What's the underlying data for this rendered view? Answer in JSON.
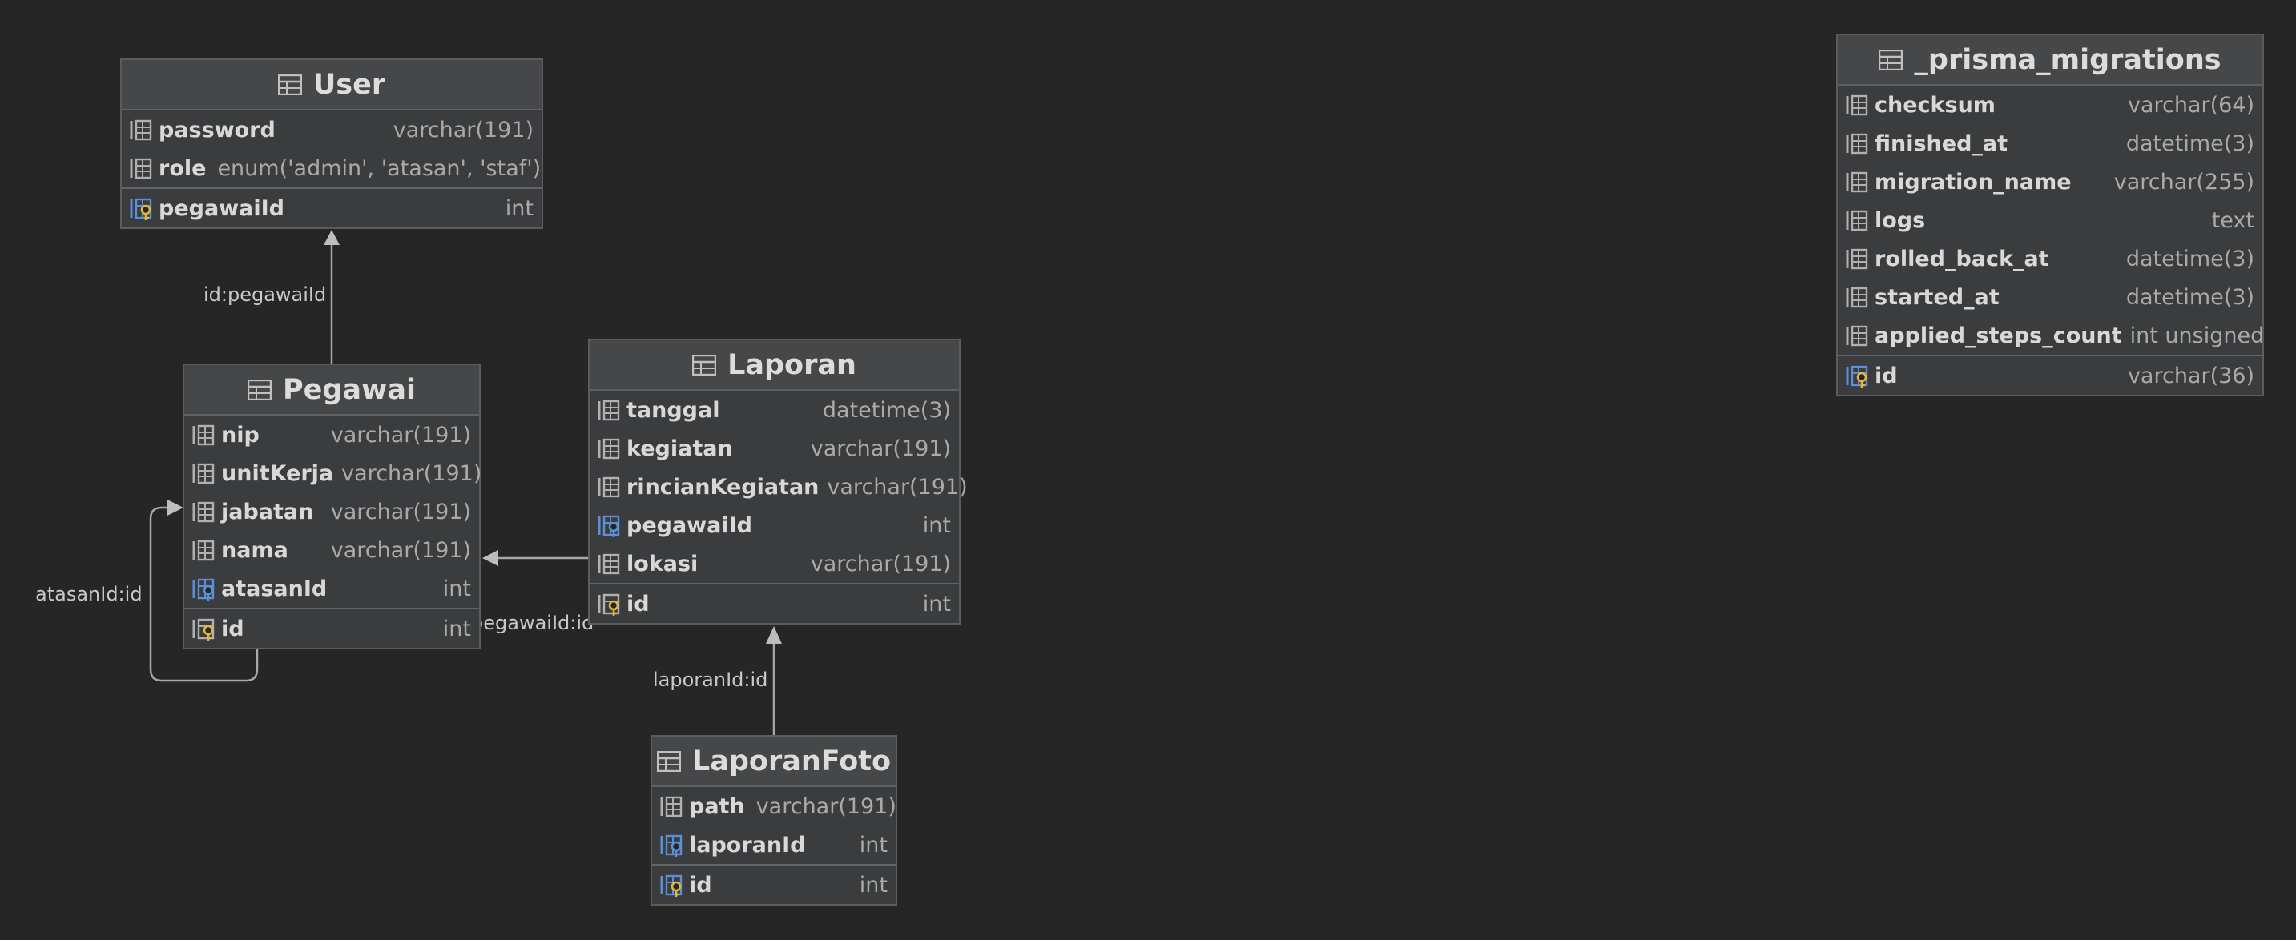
{
  "tables": {
    "user": {
      "title": "User",
      "columns": [
        {
          "name": "password",
          "type": "varchar(191)"
        },
        {
          "name": "role",
          "type": "enum('admin', 'atasan', 'staf')"
        }
      ],
      "key": {
        "name": "pegawaiId",
        "type": "int"
      }
    },
    "pegawai": {
      "title": "Pegawai",
      "columns": [
        {
          "name": "nip",
          "type": "varchar(191)"
        },
        {
          "name": "unitKerja",
          "type": "varchar(191)"
        },
        {
          "name": "jabatan",
          "type": "varchar(191)"
        },
        {
          "name": "nama",
          "type": "varchar(191)"
        },
        {
          "name": "atasanId",
          "type": "int"
        }
      ],
      "key": {
        "name": "id",
        "type": "int"
      }
    },
    "laporan": {
      "title": "Laporan",
      "columns": [
        {
          "name": "tanggal",
          "type": "datetime(3)"
        },
        {
          "name": "kegiatan",
          "type": "varchar(191)"
        },
        {
          "name": "rincianKegiatan",
          "type": "varchar(191)"
        },
        {
          "name": "pegawaiId",
          "type": "int"
        },
        {
          "name": "lokasi",
          "type": "varchar(191)"
        }
      ],
      "key": {
        "name": "id",
        "type": "int"
      }
    },
    "laporanFoto": {
      "title": "LaporanFoto",
      "columns": [
        {
          "name": "path",
          "type": "varchar(191)"
        },
        {
          "name": "laporanId",
          "type": "int"
        }
      ],
      "key": {
        "name": "id",
        "type": "int"
      }
    },
    "prismaMigrations": {
      "title": "_prisma_migrations",
      "columns": [
        {
          "name": "checksum",
          "type": "varchar(64)"
        },
        {
          "name": "finished_at",
          "type": "datetime(3)"
        },
        {
          "name": "migration_name",
          "type": "varchar(255)"
        },
        {
          "name": "logs",
          "type": "text"
        },
        {
          "name": "rolled_back_at",
          "type": "datetime(3)"
        },
        {
          "name": "started_at",
          "type": "datetime(3)"
        },
        {
          "name": "applied_steps_count",
          "type": "int unsigned"
        }
      ],
      "key": {
        "name": "id",
        "type": "varchar(36)"
      }
    }
  },
  "relations": {
    "user_pegawai": "id:pegawaiId",
    "pegawai_self": "atasanId:id",
    "laporan_pegawai": "pegawaiId:id",
    "laporanFoto_laporan": "laporanId:id"
  },
  "colors": {
    "background": "#262626",
    "table_body": "#3a3c3e",
    "table_header": "#454749",
    "edge": "#a8a8a8",
    "fk_icon": "#5b8fd6",
    "key_icon": "#e3b83a"
  }
}
